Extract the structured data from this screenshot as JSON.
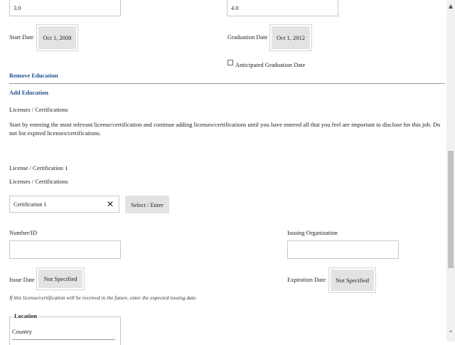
{
  "education": {
    "gpa_value": "3.0",
    "major_gpa_value": "4.0",
    "start_date_label": "Start Date",
    "start_date_value": "Oct 1, 2008",
    "graduation_date_label": "Graduation Date",
    "graduation_date_value": "Oct 1, 2012",
    "anticipated_graduation_label": "Anticipated Graduation Date",
    "remove_education_label": "Remove Education",
    "add_education_label": "Add Education"
  },
  "licenses": {
    "section_title": "Licenses / Certifications",
    "instructions": "Start by entering the most relevant license/certification and continue adding licenses/certifications until you have entered all that you feel are important to disclose for this job. Do not list expired licenses/certifications.",
    "item_title": "License / Certification 1",
    "item_subtitle": "Licenses / Certifications",
    "certification_value": "Certification 1",
    "select_enter_label": "Select / Enter",
    "number_id_label": "Number/ID",
    "issuing_org_label": "Issuing Organization",
    "issue_date_label": "Issue Date",
    "issue_date_value": "Not Specified",
    "expiration_date_label": "Expiration Date",
    "expiration_date_value": "Not Specified",
    "future_hint": "If this license/certification will be received in the future, enter the expected issuing date.",
    "location_heading": "Location",
    "country_label": "Country"
  },
  "icons": {
    "clear": "close-icon",
    "scroll_up": "chevron-up-icon",
    "scroll_down": "chevron-down-icon"
  }
}
